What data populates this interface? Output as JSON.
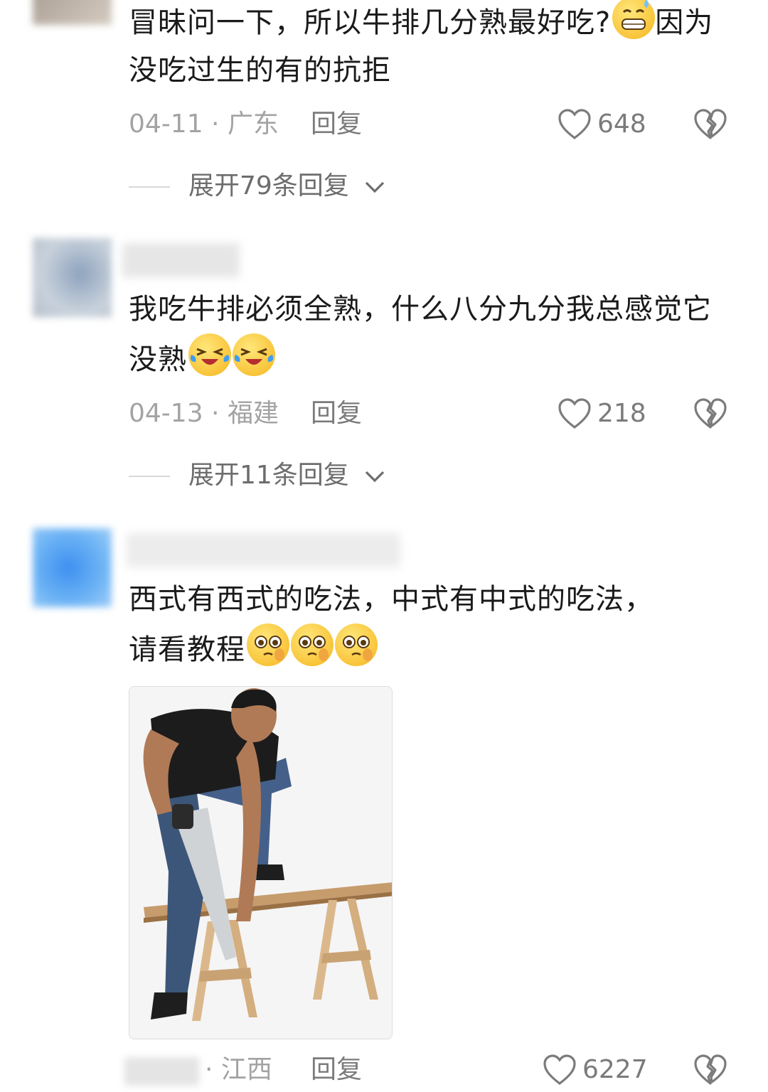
{
  "comments": [
    {
      "text_part1": "冒昧问一下，所以牛排几分熟最好吃?",
      "text_part2": "因为没吃过生的有的抗拒",
      "date": "04-11",
      "location": "广东",
      "reply_label": "回复",
      "likes": "648",
      "expand_label": "展开79条回复",
      "emoji": "grin-sweat-icon"
    },
    {
      "text": "我吃牛排必须全熟，什么八分九分我总感觉它没熟",
      "date": "04-13",
      "location": "福建",
      "reply_label": "回复",
      "likes": "218",
      "expand_label": "展开11条回复",
      "emoji": "laugh-crying-icon"
    },
    {
      "text_line1": "西式有西式的吃法，中式有中式的吃法，",
      "text_line2": "请看教程",
      "location": "江西",
      "reply_label": "回复",
      "likes": "6227",
      "emoji": "pleading-face-icon",
      "image": "man-sawing-plank-photo"
    }
  ],
  "colors": {
    "text": "#1a1a1a",
    "meta": "#a3a3a3",
    "action": "#7b7b7b"
  }
}
